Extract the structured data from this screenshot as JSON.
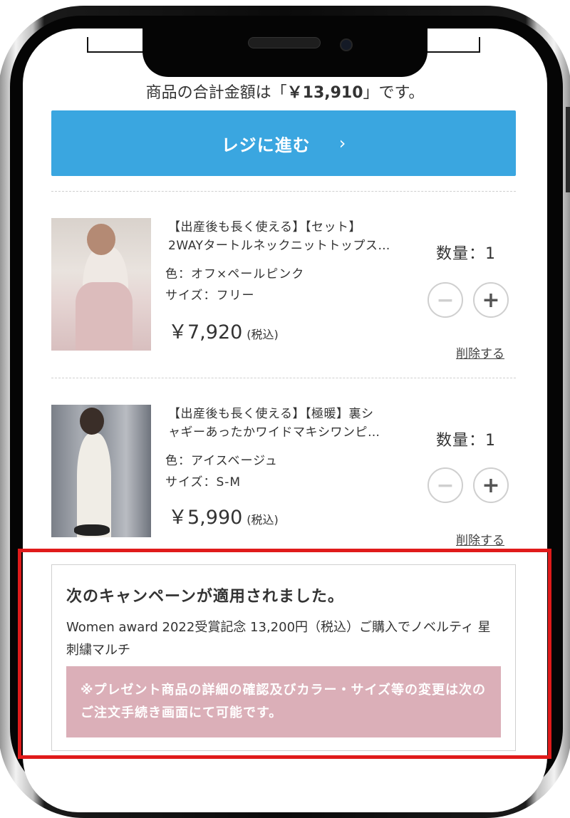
{
  "cart": {
    "total_prefix": "商品の合計金額は「",
    "total_amount": "￥13,910",
    "total_suffix": "」です。",
    "checkout_label": "レジに進む",
    "checkout_chevron": "›"
  },
  "items": [
    {
      "title_line1": "【出産後も長く使える】【セット】",
      "title_line2": "2WAYタートルネックニットトップス…",
      "color": "色：オフ×ペールピンク",
      "size": "サイズ：フリー",
      "price": "￥7,920",
      "tax_note": "(税込)",
      "qty_label": "数量：1",
      "minus_icon": "−",
      "plus_icon": "+",
      "delete_label": "削除する"
    },
    {
      "title_line1": "【出産後も長く使える】【極暖】裏シ",
      "title_line2": "ャギーあったかワイドマキシワンピ…",
      "color": "色：アイスベージュ",
      "size": "サイズ：S-M",
      "price": "￥5,990",
      "tax_note": "(税込)",
      "qty_label": "数量：1",
      "minus_icon": "−",
      "plus_icon": "+",
      "delete_label": "削除する"
    }
  ],
  "campaign": {
    "title": "次のキャンペーンが適用されました。",
    "description": "Women award 2022受賞記念 13,200円（税込）ご購入でノベルティ 星刺繍マルチ",
    "note": "※プレゼント商品の詳細の確認及びカラー・サイズ等の変更は次のご注文手続き画面にて可能です。"
  },
  "colors": {
    "accent_blue": "#3aa6e0",
    "note_pink": "#dbafb8",
    "highlight_red": "#e01b1b"
  }
}
